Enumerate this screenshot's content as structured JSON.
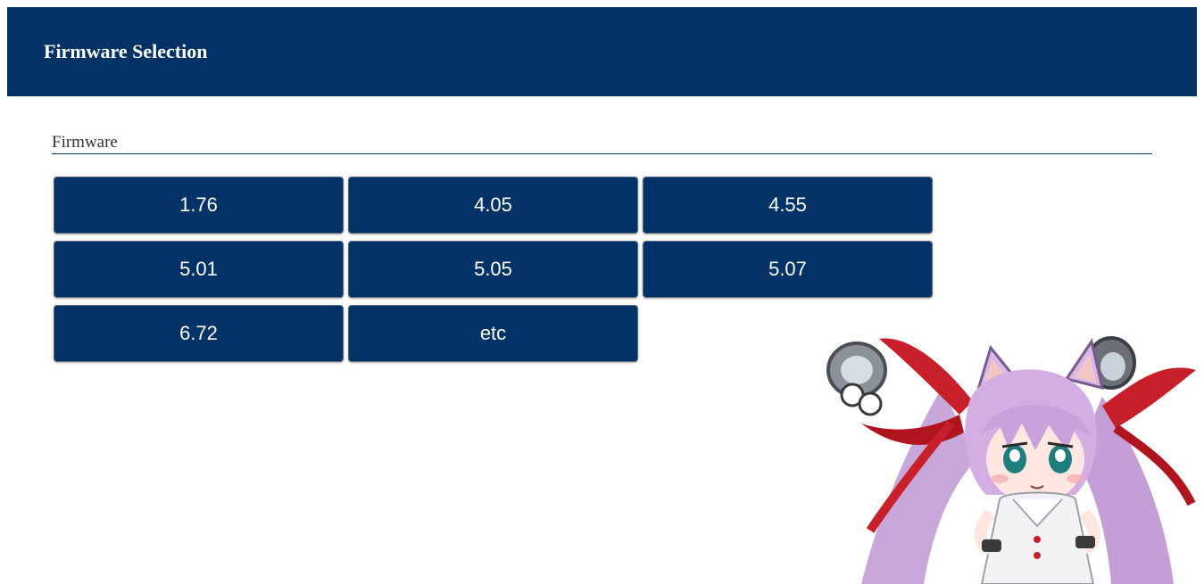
{
  "header": {
    "title": "Firmware Selection"
  },
  "section": {
    "label": "Firmware"
  },
  "firmware_buttons": [
    {
      "label": "1.76"
    },
    {
      "label": "4.05"
    },
    {
      "label": "4.55"
    },
    {
      "label": "5.01"
    },
    {
      "label": "5.05"
    },
    {
      "label": "5.07"
    },
    {
      "label": "6.72"
    },
    {
      "label": "etc"
    }
  ],
  "colors": {
    "brand": "#033266",
    "text_on_brand": "#ffffff"
  },
  "icons": {
    "mascot": "anime-catgirl-mascot-illustration"
  }
}
